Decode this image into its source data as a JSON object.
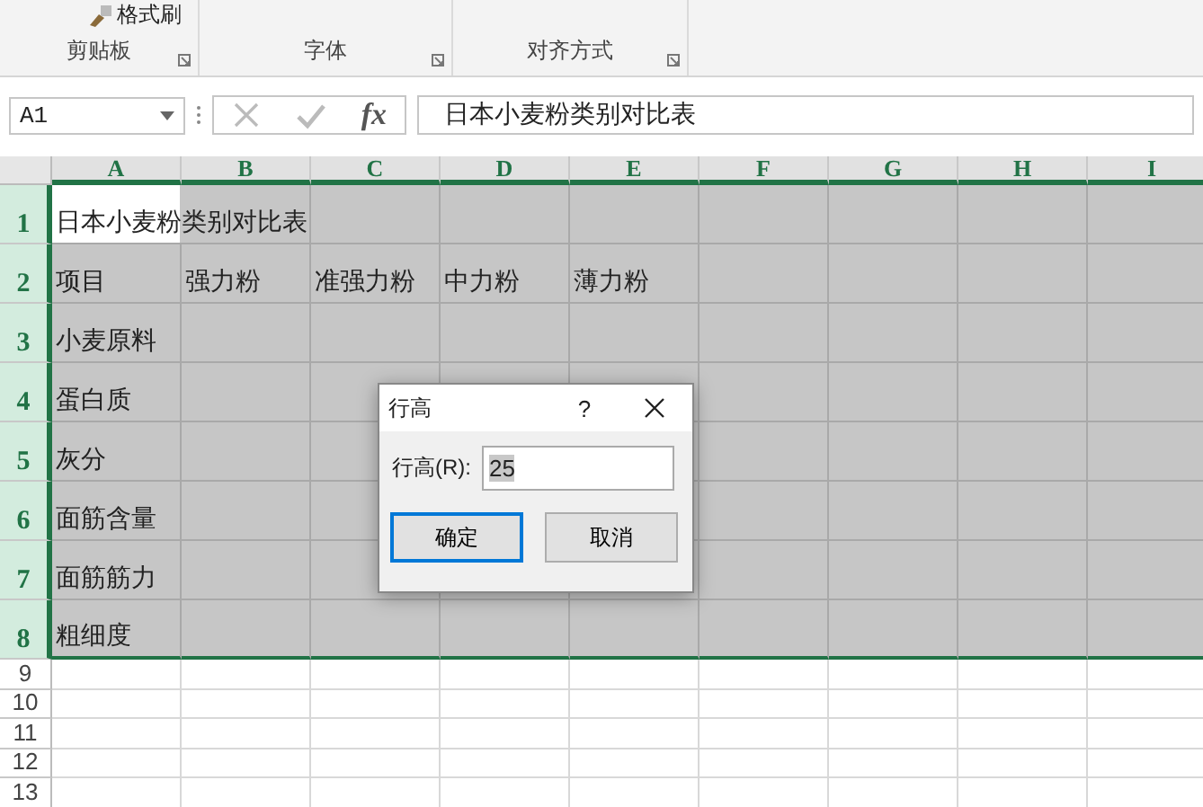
{
  "ribbon": {
    "format_painter": "格式刷",
    "groups": [
      "剪贴板",
      "字体",
      "对齐方式"
    ]
  },
  "formula_bar": {
    "name_box": "A1",
    "fx": "fx",
    "value": "日本小麦粉类别对比表"
  },
  "sheet": {
    "columns": [
      "A",
      "B",
      "C",
      "D",
      "E",
      "F",
      "G",
      "H",
      "I"
    ],
    "rows": [
      {
        "label": "1",
        "selected": true,
        "cells": [
          "日本小麦粉类别对比表"
        ]
      },
      {
        "label": "2",
        "selected": true,
        "cells": [
          "项目",
          "强力粉",
          "准强力粉",
          "中力粉",
          "薄力粉"
        ]
      },
      {
        "label": "3",
        "selected": true,
        "cells": [
          "小麦原料"
        ]
      },
      {
        "label": "4",
        "selected": true,
        "cells": [
          "蛋白质"
        ]
      },
      {
        "label": "5",
        "selected": true,
        "cells": [
          "灰分"
        ]
      },
      {
        "label": "6",
        "selected": true,
        "cells": [
          "面筋含量"
        ]
      },
      {
        "label": "7",
        "selected": true,
        "cells": [
          "面筋筋力"
        ]
      },
      {
        "label": "8",
        "selected": true,
        "cells": [
          "粗细度"
        ]
      },
      {
        "label": "9",
        "selected": false,
        "cells": []
      },
      {
        "label": "10",
        "selected": false,
        "cells": []
      },
      {
        "label": "11",
        "selected": false,
        "cells": []
      },
      {
        "label": "12",
        "selected": false,
        "cells": []
      },
      {
        "label": "13",
        "selected": false,
        "cells": []
      }
    ]
  },
  "dialog": {
    "title": "行高",
    "help": "?",
    "field_label": "行高(R):",
    "value": "25",
    "ok": "确定",
    "cancel": "取消"
  }
}
